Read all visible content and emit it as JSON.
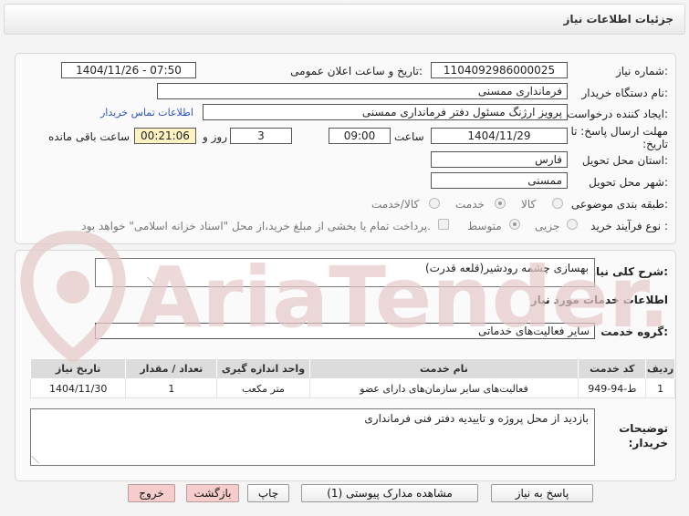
{
  "header": {
    "title": "جزئیات اطلاعات نیاز"
  },
  "form": {
    "need_number": {
      "label": "شماره نیاز:",
      "value": "1104092986000025"
    },
    "announce_datetime": {
      "label": "تاریخ و ساعت اعلان عمومی:",
      "value": "1404/11/26 - 07:50"
    },
    "buyer_org": {
      "label": "نام دستگاه خریدار:",
      "value": "فرمانداری ممسنی"
    },
    "creator": {
      "label": "ایجاد کننده درخواست:",
      "value": "پرویز ارژنگ مسئول دفتر فرمانداری ممسنی",
      "contact_link": "اطلاعات تماس خریدار"
    },
    "deadline": {
      "label": "مهلت ارسال پاسخ: تا تاریخ:",
      "date": "1404/11/29",
      "time_label": "ساعت",
      "time": "09:00",
      "days": "3",
      "days_label": "روز و",
      "remaining": "00:21:06",
      "remaining_label": "ساعت باقی مانده"
    },
    "province": {
      "label": "استان محل تحویل:",
      "value": "فارس"
    },
    "city": {
      "label": "شهر محل تحویل:",
      "value": "ممسنی"
    },
    "category": {
      "label": "طبقه بندی موضوعی:",
      "options": [
        "کالا",
        "خدمت",
        "کالا/خدمت"
      ],
      "selected": "خدمت"
    },
    "process_type": {
      "label": "نوع فرآیند خرید :",
      "options": [
        "جزیی",
        "متوسط"
      ],
      "selected": "متوسط",
      "note": "پرداخت تمام یا بخشی از مبلغ خرید،از محل \"اسناد خزانه اسلامی\" خواهد بود."
    }
  },
  "summary": {
    "label": "شرح کلی نیاز:",
    "value": "بهسازی چشمه رودشیر(قلعه قدرت)"
  },
  "services": {
    "section_title": "اطلاعات خدمات مورد نیاز",
    "group_label": "گروه خدمت:",
    "group_value": "سایر فعالیت‌های خدماتی",
    "columns": [
      "ردیف",
      "کد خدمت",
      "نام خدمت",
      "واحد اندازه گیری",
      "تعداد / مقدار",
      "تاریخ نیاز"
    ],
    "rows": [
      [
        "1",
        "ط-94-949",
        "فعالیت‌های سایر سازمان‌های دارای عضو",
        "متر مکعب",
        "1",
        "1404/11/30"
      ]
    ]
  },
  "buyer_notes": {
    "label": "توضیحات خریدار:",
    "value": "بازدید از محل پروژه و تاییدیه دفتر فنی فرمانداری"
  },
  "buttons": {
    "reply": "پاسخ به نیاز",
    "attachments": "مشاهده مدارک پیوستی (1)",
    "print": "چاپ",
    "back": "بازگشت",
    "exit": "خروج"
  },
  "watermark": {
    "text": "AriaTender.net"
  },
  "colors": {
    "link": "#2a55c8",
    "remaining_bg": "#fff3c4",
    "pink_button": "#f7cccc",
    "watermark": "#e6c9c9"
  }
}
